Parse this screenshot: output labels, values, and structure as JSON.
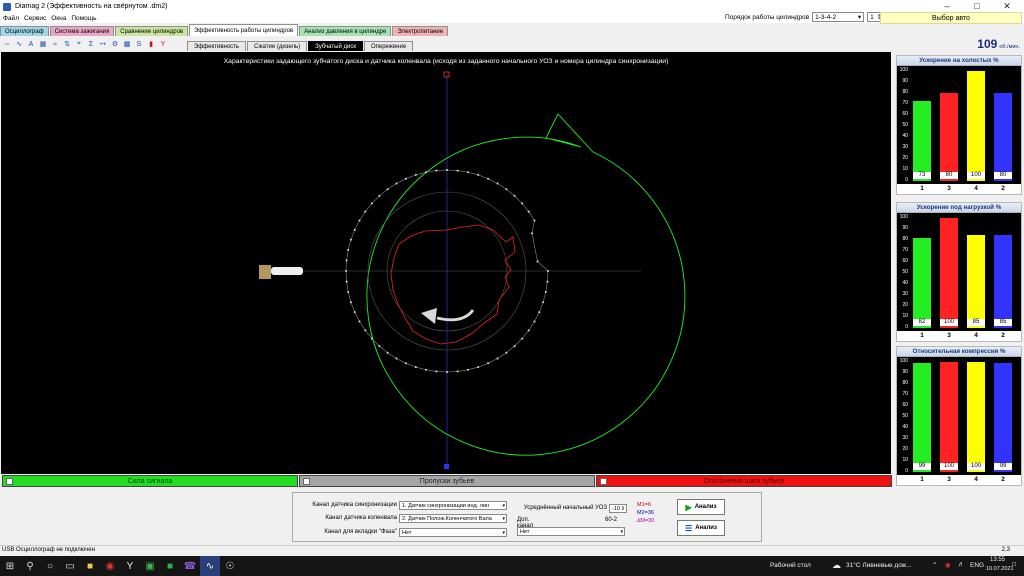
{
  "window": {
    "title": "Diamag 2 (Эффективность на свёрнутом .dm2)"
  },
  "menu": [
    "Файл",
    "Сервис",
    "Окна",
    "Помощь"
  ],
  "cylinder_order": {
    "label": "Порядок работы цилиндров",
    "value": "1-3-4-2",
    "count": "1"
  },
  "select_auto": "Выбор авто",
  "main_tabs": [
    {
      "label": "Осциллограф",
      "color": "#9fd4e8"
    },
    {
      "label": "Система зажигания",
      "color": "#e9a6c6"
    },
    {
      "label": "Сравнение цилиндров",
      "color": "#c8e6a0"
    },
    {
      "label": "Эффективность работы цилиндров",
      "color": "#ffffff"
    },
    {
      "label": "Анализ давления в цилиндре",
      "color": "#a6e3b3"
    },
    {
      "label": "Электропитание",
      "color": "#efb3b3"
    }
  ],
  "sub_tabs": [
    "Эффективность",
    "Сжатие (дизель)",
    "Зубчатый диск",
    "Опережение"
  ],
  "active_sub_tab": 2,
  "rpm": {
    "value": "109",
    "unit": "об./мин."
  },
  "scope": {
    "title": "Характеристики задающего зубчатого диска и датчика коленвала (исходя из заданного начального УОЗ и номера цилиндра синхронизации)"
  },
  "bottom_bars": {
    "signal": "Сила сигнала",
    "skips": "Пропуски зубьев",
    "deviation": "Отклонения шага зубьев"
  },
  "charts": [
    {
      "title": "Ускорение на холостых %",
      "cylinders": [
        "1",
        "3",
        "4",
        "2"
      ],
      "values": [
        73,
        80,
        100,
        80
      ],
      "colors": [
        "#22ee22",
        "#ff2222",
        "#ffff00",
        "#3333ff"
      ],
      "ticks": [
        "100",
        "90",
        "80",
        "70",
        "60",
        "50",
        "40",
        "30",
        "20",
        "10",
        "0"
      ]
    },
    {
      "title": "Ускорение под нагрузкой %",
      "cylinders": [
        "1",
        "3",
        "4",
        "2"
      ],
      "values": [
        82,
        100,
        85,
        85
      ],
      "colors": [
        "#22ee22",
        "#ff2222",
        "#ffff00",
        "#3333ff"
      ],
      "ticks": [
        "100",
        "90",
        "80",
        "70",
        "60",
        "50",
        "40",
        "30",
        "20",
        "10",
        "0"
      ]
    },
    {
      "title": "Относительная компрессия %",
      "cylinders": [
        "1",
        "3",
        "4",
        "2"
      ],
      "values": [
        99,
        100,
        100,
        99
      ],
      "colors": [
        "#22ee22",
        "#ff2222",
        "#ffff00",
        "#3333ff"
      ],
      "ticks": [
        "100",
        "90",
        "80",
        "70",
        "60",
        "50",
        "40",
        "30",
        "20",
        "10",
        "0"
      ]
    }
  ],
  "controls": {
    "sync_channel_label": "Канал датчика синхронизации",
    "sync_channel_value": "1. Датчик синхронизации инд. лин",
    "crank_channel_label": "Канал датчика коленвала",
    "crank_channel_value": "2. Датчик Полож.Коленчатого Вала",
    "phase_channel_label": "Канал для вкладки \"Фаза\"",
    "phase_channel_value": "Нет",
    "avg_uoz_label": "Усреднённый начальный УОЗ",
    "avg_uoz_value": "-10",
    "extra_channel_label": "Доп. канал",
    "disc_type": "60-2",
    "extra_channel_value": "Нет",
    "m1": "M1=6",
    "m2": "M2=36",
    "dm": "∆M=30",
    "analyze1": "Анализ",
    "analyze2": "Анализ"
  },
  "status": {
    "left": "USB Осциллограф не подключен",
    "right": "2.3"
  },
  "taskbar": {
    "desktop": "Рабочий стол",
    "weather": "31°C  Ливневые дож...",
    "lang": "ENG",
    "time": "13:55",
    "date": "10.07.2021"
  }
}
